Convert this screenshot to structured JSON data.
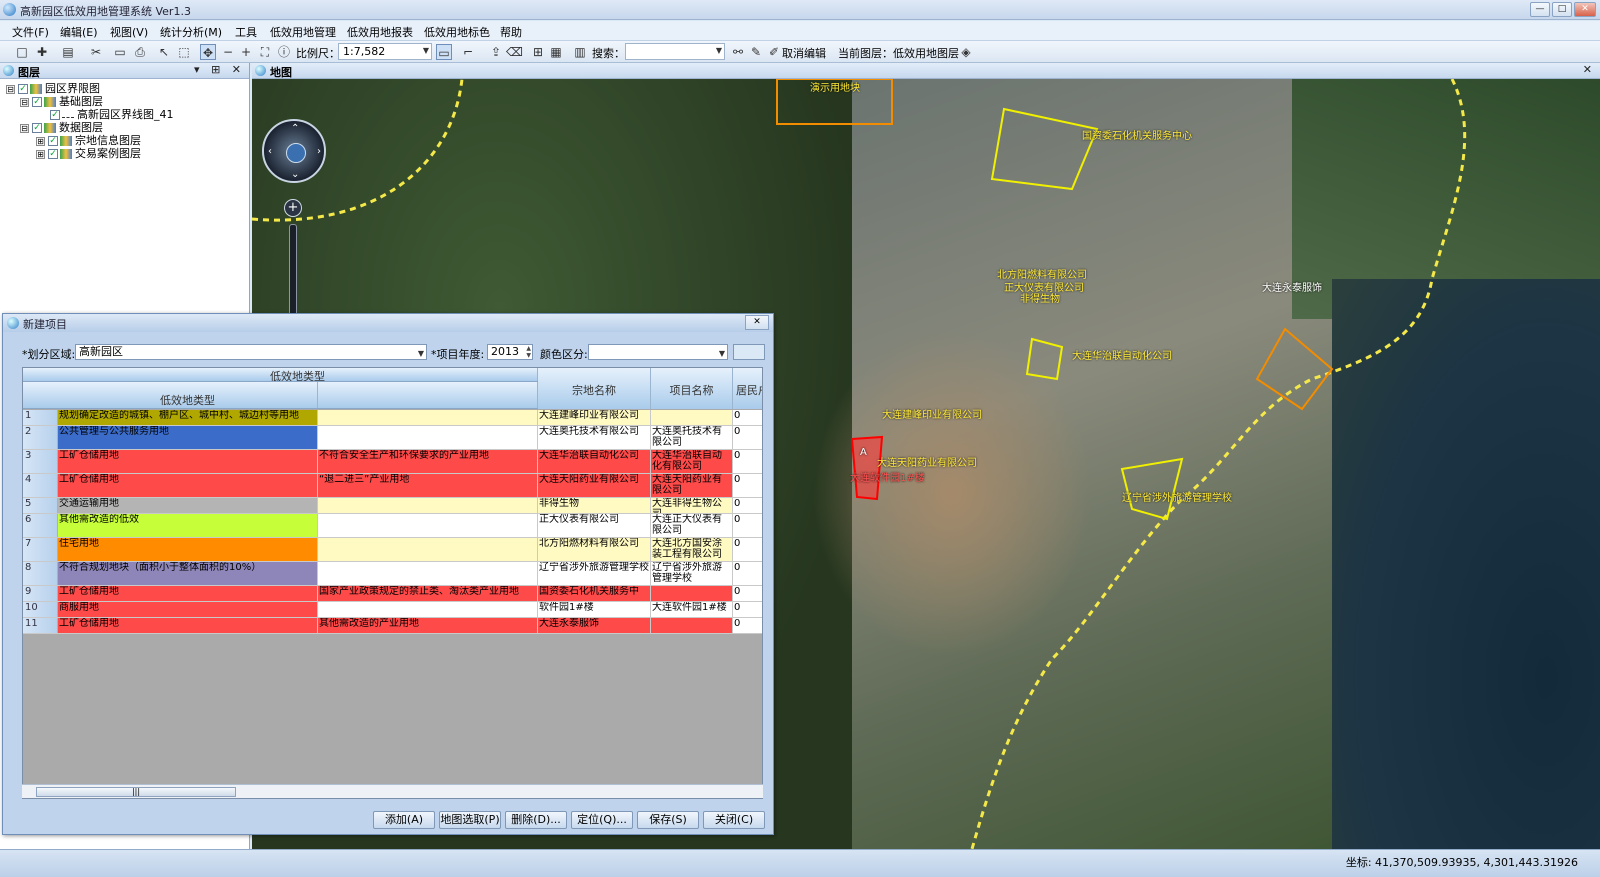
{
  "window": {
    "title": "高新园区低效用地管理系统 Ver1.3",
    "min": "—",
    "max": "□",
    "close": "✕"
  },
  "menu": [
    "文件(F)",
    "编辑(E)",
    "视图(V)",
    "统计分析(M)",
    "工具",
    "低效用地管理",
    "低效用地报表",
    "低效用地标色",
    "帮助"
  ],
  "toolbar": {
    "scale_label": "比例尺：",
    "scale_value": "1:7,582",
    "search_label": "搜索：",
    "cancel_edit": "取消编辑",
    "current_layer": "当前图层：低效用地图层"
  },
  "layers_panel": {
    "title": "图层",
    "pin": "▾ ⊞ ✕",
    "tree": [
      {
        "label": "园区界限图",
        "level": 0,
        "exp": "⊟"
      },
      {
        "label": "基础图层",
        "level": 1,
        "exp": "⊟"
      },
      {
        "label": "高新园区界线图_41",
        "level": 2,
        "exp": ""
      },
      {
        "label": "数据图层",
        "level": 1,
        "exp": "⊟"
      },
      {
        "label": "宗地信息图层",
        "level": 2,
        "exp": "⊞"
      },
      {
        "label": "交易案例图层",
        "level": 2,
        "exp": "⊞"
      }
    ]
  },
  "map_panel": {
    "title": "地图",
    "close": "✕"
  },
  "map_labels": [
    "演示用地块",
    "国资委石化机关服务中心",
    "大连永泰服饰",
    "北方阳燃料有限公司",
    "正大仪表有限公司",
    "非得生物",
    "大连华治联自动化公司",
    "大连建峰印业有限公司",
    "大连天阳药业有限公司",
    "辽宁省涉外旅游管理学校",
    "大连软件园1#楼",
    "A"
  ],
  "dialog": {
    "title": "新建项目",
    "close": "✕",
    "region_label": "*划分区域:",
    "region_value": "高新园区",
    "year_label": "*项目年度:",
    "year_value": "2013",
    "color_label": "颜色区分:",
    "color_value": "",
    "buttons": [
      "添加(A)",
      "地图选取(P)",
      "删除(D)...",
      "定位(Q)...",
      "保存(S)",
      "关闭(C)"
    ]
  },
  "grid": {
    "group_header": "低效地类型",
    "headers": [
      "低效地类型",
      "",
      "宗地名称",
      "项目名称",
      "居民户"
    ],
    "rows": [
      {
        "n": "1",
        "type": "规划确定改造的城镇、棚户区、城中村、城边村等用地",
        "sub": "",
        "parcel": "大连建峰印业有限公司",
        "project": "",
        "res": "0",
        "c": "#b0a800",
        "sc": "#fff9c2"
      },
      {
        "n": "2",
        "type": "公共管理与公共服务用地",
        "sub": "",
        "parcel": "大连奥托技术有限公司",
        "project": "大连奥托技术有限公司",
        "res": "0",
        "c": "#3c6cc9",
        "sc": "#ffffff"
      },
      {
        "n": "3",
        "type": "工矿仓储用地",
        "sub": "不符合安全生产和环保要求的产业用地",
        "parcel": "大连华治联自动化公司",
        "project": "大连华治联自动化有限公司",
        "res": "0",
        "c": "#ff4a4a",
        "sc": "#ff4a4a"
      },
      {
        "n": "4",
        "type": "工矿仓储用地",
        "sub": "“退二进三”产业用地",
        "parcel": "大连天阳药业有限公司",
        "project": "大连天阳药业有限公司",
        "res": "0",
        "c": "#ff4a4a",
        "sc": "#ff4a4a"
      },
      {
        "n": "5",
        "type": "交通运输用地",
        "sub": "",
        "parcel": "非得生物",
        "project": "大连非得生物公司",
        "res": "0",
        "c": "#b4b4b4",
        "sc": "#fff9c2"
      },
      {
        "n": "6",
        "type": "其他需改造的低效",
        "sub": "",
        "parcel": "正大仪表有限公司",
        "project": "大连正大仪表有限公司",
        "res": "0",
        "c": "#c6ff3a",
        "sc": "#ffffff"
      },
      {
        "n": "7",
        "type": "住宅用地",
        "sub": "",
        "parcel": "北方阳燃材料有限公司",
        "project": "大连北方国安涂装工程有限公司",
        "res": "0",
        "c": "#ff8c00",
        "sc": "#fff9c2"
      },
      {
        "n": "8",
        "type": "不符合规划地块（面积小于整体面积的10%）",
        "sub": "",
        "parcel": "辽宁省涉外旅游管理学校",
        "project": "辽宁省涉外旅游管理学校",
        "res": "0",
        "c": "#8e86b8",
        "sc": "#ffffff"
      },
      {
        "n": "9",
        "type": "工矿仓储用地",
        "sub": "国家产业政策规定的禁止类、淘汰类产业用地",
        "parcel": "国资委石化机关服务中",
        "project": "",
        "res": "0",
        "c": "#ff4a4a",
        "sc": "#ff4a4a"
      },
      {
        "n": "10",
        "type": "商服用地",
        "sub": "",
        "parcel": "软件园1#楼",
        "project": "大连软件园1#楼",
        "res": "0",
        "c": "#ff4a4a",
        "sc": "#ffffff"
      },
      {
        "n": "11",
        "type": "工矿仓储用地",
        "sub": "其他需改造的产业用地",
        "parcel": "大连永泰服饰",
        "project": "",
        "res": "0",
        "c": "#ff4a4a",
        "sc": "#ff4a4a"
      }
    ]
  },
  "status": {
    "coords": "坐标: 41,370,509.93935, 4,301,443.31926"
  }
}
